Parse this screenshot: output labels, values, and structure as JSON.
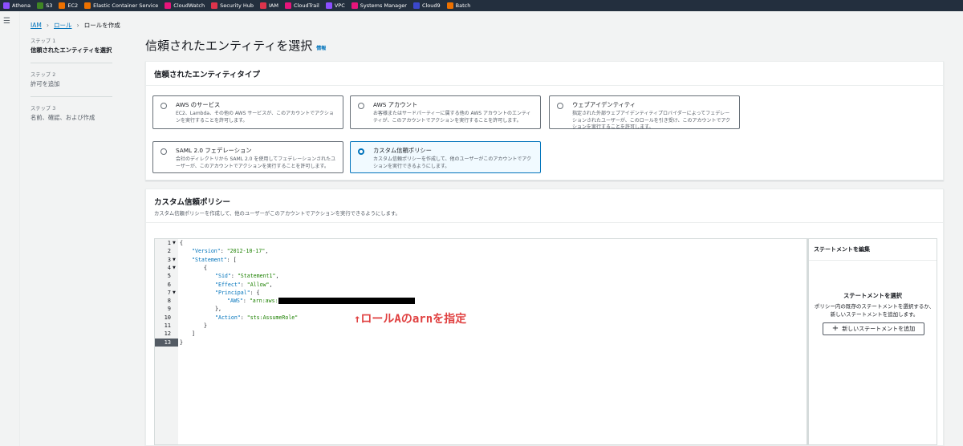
{
  "topbar": {
    "services": [
      {
        "label": "Athena",
        "color": "#8c4fff"
      },
      {
        "label": "S3",
        "color": "#3f8624"
      },
      {
        "label": "EC2",
        "color": "#ed7100"
      },
      {
        "label": "Elastic Container Service",
        "color": "#ed7100"
      },
      {
        "label": "CloudWatch",
        "color": "#e7157b"
      },
      {
        "label": "Security Hub",
        "color": "#dd344c"
      },
      {
        "label": "IAM",
        "color": "#dd344c"
      },
      {
        "label": "CloudTrail",
        "color": "#e7157b"
      },
      {
        "label": "VPC",
        "color": "#8c4fff"
      },
      {
        "label": "Systems Manager",
        "color": "#e7157b"
      },
      {
        "label": "Cloud9",
        "color": "#3b48cc"
      },
      {
        "label": "Batch",
        "color": "#ed7100"
      }
    ]
  },
  "breadcrumb": {
    "iam": "IAM",
    "roles": "ロール",
    "current": "ロールを作成"
  },
  "steps": [
    {
      "num": "ステップ 1",
      "title": "信頼されたエンティティを選択"
    },
    {
      "num": "ステップ 2",
      "title": "許可を追加"
    },
    {
      "num": "ステップ 3",
      "title": "名前、確認、および作成"
    }
  ],
  "page": {
    "title": "信頼されたエンティティを選択",
    "info": "情報"
  },
  "entity_panel": {
    "title": "信頼されたエンティティタイプ",
    "options": [
      {
        "title": "AWS のサービス",
        "desc": "EC2、Lambda、その他の AWS サービスが、このアカウントでアクションを実行することを許可します。"
      },
      {
        "title": "AWS アカウント",
        "desc": "お客様またはサードパーティーに属する他の AWS アカウントのエンティティが、このアカウントでアクションを実行することを許可します。"
      },
      {
        "title": "ウェブアイデンティティ",
        "desc": "指定された外部ウェブアイデンティティプロバイダーによってフェデレーションされたユーザーが、このロールを引き受け、このアカウントでアクションを実行することを許可します。"
      },
      {
        "title": "SAML 2.0 フェデレーション",
        "desc": "会社のディレクトリから SAML 2.0 を使用してフェデレーションされたユーザーが、このアカウントでアクションを実行することを許可します。"
      },
      {
        "title": "カスタム信頼ポリシー",
        "desc": "カスタム信頼ポリシーを作成して、他のユーザーがこのアカウントでアクションを実行できるようにします。"
      }
    ],
    "selected_index": 4
  },
  "policy_panel": {
    "title": "カスタム信頼ポリシー",
    "desc": "カスタム信頼ポリシーを作成して、他のユーザーがこのアカウントでアクションを実行できるようにします。"
  },
  "editor": {
    "line_numbers": [
      "1",
      "2",
      "3",
      "4",
      "5",
      "6",
      "7",
      "8",
      "9",
      "10",
      "11",
      "12",
      "13"
    ],
    "active_line": "13",
    "code": {
      "l1": "{",
      "l2k": "\"Version\"",
      "l2v": "\"2012-10-17\"",
      "l3k": "\"Statement\"",
      "l3v": "[",
      "l4": "{",
      "l5k": "\"Sid\"",
      "l5v": "\"Statement1\"",
      "l6k": "\"Effect\"",
      "l6v": "\"Allow\"",
      "l7k": "\"Principal\"",
      "l7v": "{",
      "l8k": "\"AWS\"",
      "l8v": "\"arn:aws:",
      "l9": "},",
      "l10k": "\"Action\"",
      "l10v": "\"sts:AssumeRole\"",
      "l11": "}",
      "l12": "]",
      "l13": "}"
    },
    "annotation": "↑ロールAのarnを指定"
  },
  "statement_sidebar": {
    "header": "ステートメントを編集",
    "title": "ステートメントを選択",
    "desc": "ポリシー内の既存のステートメントを選択するか、新しいステートメントを追加します。",
    "add_button": "新しいステートメントを追加"
  }
}
